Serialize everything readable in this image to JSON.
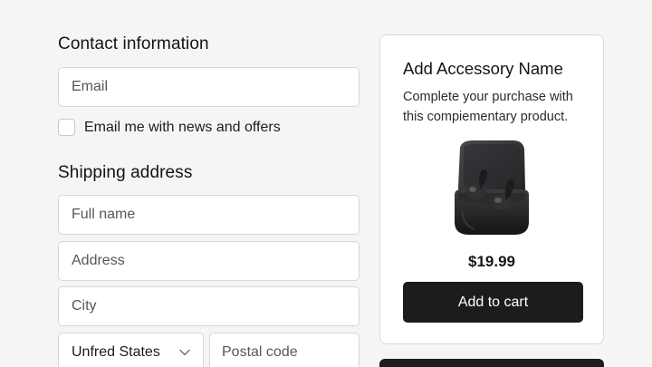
{
  "contact": {
    "title": "Contact information",
    "email_placeholder": "Email",
    "newsletter_label": "Email me with news and offers"
  },
  "shipping": {
    "title": "Shipping address",
    "full_name_placeholder": "Full name",
    "address_placeholder": "Address",
    "city_placeholder": "City",
    "country_value": "Unfred States",
    "postal_placeholder": "Postal code"
  },
  "accessory": {
    "title": "Add Accessory Name",
    "description": "Complete your purchase with this compiementary product.",
    "image_icon": "earbuds-case-icon",
    "price": "$19.99",
    "button_label": "Add to cart"
  },
  "colors": {
    "background": "#f5f5f5",
    "button": "#1c1c1c",
    "button_text": "#ffffff"
  }
}
